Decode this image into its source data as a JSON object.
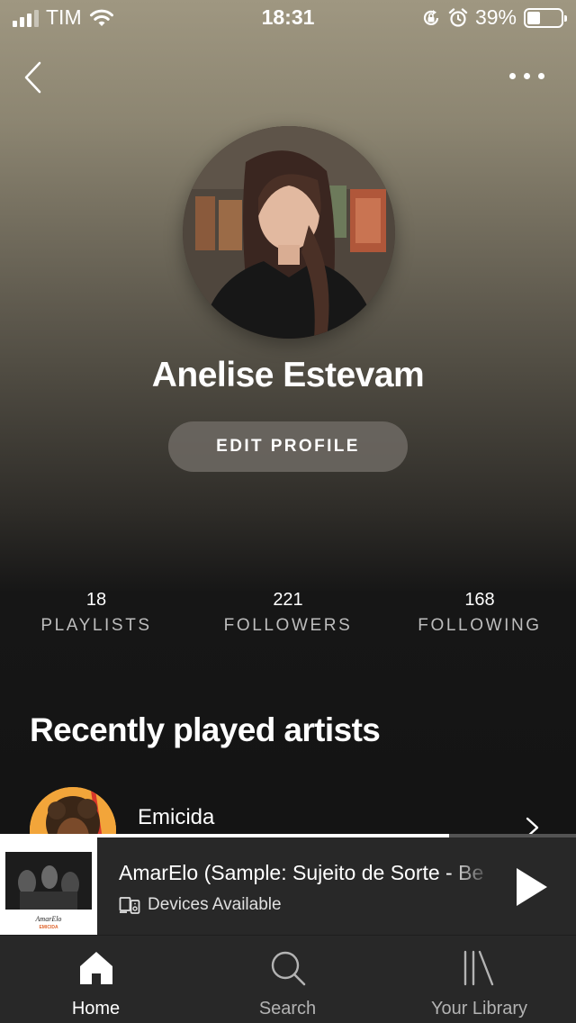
{
  "status_bar": {
    "carrier": "TIM",
    "time": "18:31",
    "battery_percent": "39%",
    "battery_level": 0.39,
    "icons": [
      "signal-icon",
      "wifi-icon",
      "rotation-lock-icon",
      "alarm-icon",
      "battery-icon"
    ]
  },
  "header": {
    "back_icon": "chevron-left-icon",
    "more_icon": "more-horizontal-icon"
  },
  "profile": {
    "name": "Anelise Estevam",
    "edit_label": "EDIT PROFILE"
  },
  "stats": [
    {
      "value": "18",
      "label": "PLAYLISTS"
    },
    {
      "value": "221",
      "label": "FOLLOWERS"
    },
    {
      "value": "168",
      "label": "FOLLOWING"
    }
  ],
  "recent": {
    "title": "Recently played artists",
    "artists": [
      {
        "name": "Emicida"
      }
    ]
  },
  "now_playing": {
    "title": "AmarElo (Sample: Sujeito de Sorte - Be",
    "devices": "Devices Available",
    "progress": 0.78,
    "cover_text": "AmarElo",
    "cover_subtext": "EMICIDA"
  },
  "tabs": [
    {
      "label": "Home",
      "icon": "home-icon",
      "active": true
    },
    {
      "label": "Search",
      "icon": "search-icon",
      "active": false
    },
    {
      "label": "Your Library",
      "icon": "library-icon",
      "active": false
    }
  ],
  "colors": {
    "background": "#121212",
    "bar": "#282828",
    "header_gradient_top": "#9f9781",
    "inactive_text": "#b3b3b3"
  }
}
